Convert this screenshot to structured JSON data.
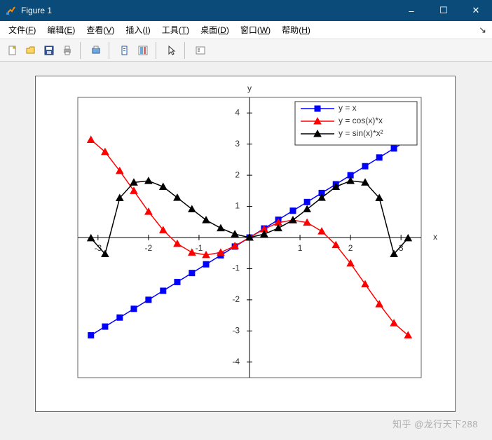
{
  "window": {
    "title": "Figure 1",
    "minimize": "–",
    "maximize": "☐",
    "close": "✕"
  },
  "menubar": {
    "file": {
      "label": "文件",
      "accel": "F"
    },
    "edit": {
      "label": "编辑",
      "accel": "E"
    },
    "view": {
      "label": "查看",
      "accel": "V"
    },
    "insert": {
      "label": "插入",
      "accel": "I"
    },
    "tools": {
      "label": "工具",
      "accel": "T"
    },
    "desktop": {
      "label": "桌面",
      "accel": "D"
    },
    "window": {
      "label": "窗口",
      "accel": "W"
    },
    "help": {
      "label": "帮助",
      "accel": "H"
    },
    "pin": "↘"
  },
  "toolbar": {
    "new": "new-file-icon",
    "open": "open-folder-icon",
    "save": "save-icon",
    "print": "print-icon",
    "printpreview": "print-preview-icon",
    "link": "link-icon",
    "showplot": "show-plot-icon",
    "cursor": "pointer-icon",
    "datatips": "insert-legend-icon"
  },
  "chart_data": {
    "type": "line",
    "xlabel": "x",
    "ylabel": "y",
    "xlim": [
      -3.4,
      3.4
    ],
    "ylim": [
      -4.5,
      4.5
    ],
    "xticks": [
      -3,
      -2,
      -1,
      1,
      2,
      3
    ],
    "yticks": [
      -4,
      -3,
      -2,
      -1,
      1,
      2,
      3,
      4
    ],
    "series": [
      {
        "name": "y = x",
        "color": "#0000ff",
        "marker": "square",
        "x": [
          -3.14,
          -2.86,
          -2.57,
          -2.29,
          -2.0,
          -1.71,
          -1.43,
          -1.14,
          -0.86,
          -0.57,
          -0.29,
          0.0,
          0.29,
          0.57,
          0.86,
          1.14,
          1.43,
          1.71,
          2.0,
          2.29,
          2.57,
          2.86,
          3.14
        ],
        "y": [
          -3.14,
          -2.86,
          -2.57,
          -2.29,
          -2.0,
          -1.71,
          -1.43,
          -1.14,
          -0.86,
          -0.57,
          -0.29,
          0.0,
          0.29,
          0.57,
          0.86,
          1.14,
          1.43,
          1.71,
          2.0,
          2.29,
          2.57,
          2.86,
          3.14
        ]
      },
      {
        "name": "y = cos(x)*x",
        "color": "#ff0000",
        "marker": "triangle",
        "x": [
          -3.14,
          -2.86,
          -2.57,
          -2.29,
          -2.0,
          -1.71,
          -1.43,
          -1.14,
          -0.86,
          -0.57,
          -0.29,
          0.0,
          0.29,
          0.57,
          0.86,
          1.14,
          1.43,
          1.71,
          2.0,
          2.29,
          2.57,
          2.86,
          3.14
        ],
        "y": [
          3.14,
          2.75,
          2.14,
          1.5,
          0.83,
          0.24,
          -0.2,
          -0.48,
          -0.56,
          -0.48,
          -0.27,
          0.0,
          0.27,
          0.48,
          0.56,
          0.48,
          0.2,
          -0.24,
          -0.83,
          -1.5,
          -2.14,
          -2.75,
          -3.14
        ]
      },
      {
        "name": "y = sin(x)*x²",
        "color": "#000000",
        "marker": "triangle",
        "x": [
          -3.14,
          -2.86,
          -2.57,
          -2.29,
          -2.0,
          -1.71,
          -1.43,
          -1.14,
          -0.86,
          -0.57,
          -0.29,
          0.0,
          0.29,
          0.57,
          0.86,
          1.14,
          1.43,
          1.71,
          2.0,
          2.29,
          2.57,
          2.86,
          3.14
        ],
        "y": [
          -0.02,
          -0.53,
          1.27,
          1.77,
          1.82,
          1.63,
          1.28,
          0.91,
          0.56,
          0.3,
          0.11,
          0.0,
          0.11,
          0.3,
          0.56,
          0.91,
          1.28,
          1.63,
          1.82,
          1.77,
          1.27,
          -0.53,
          -0.02
        ]
      }
    ],
    "legend_position": "northeast"
  },
  "watermark": "知乎 @龙行天下288"
}
